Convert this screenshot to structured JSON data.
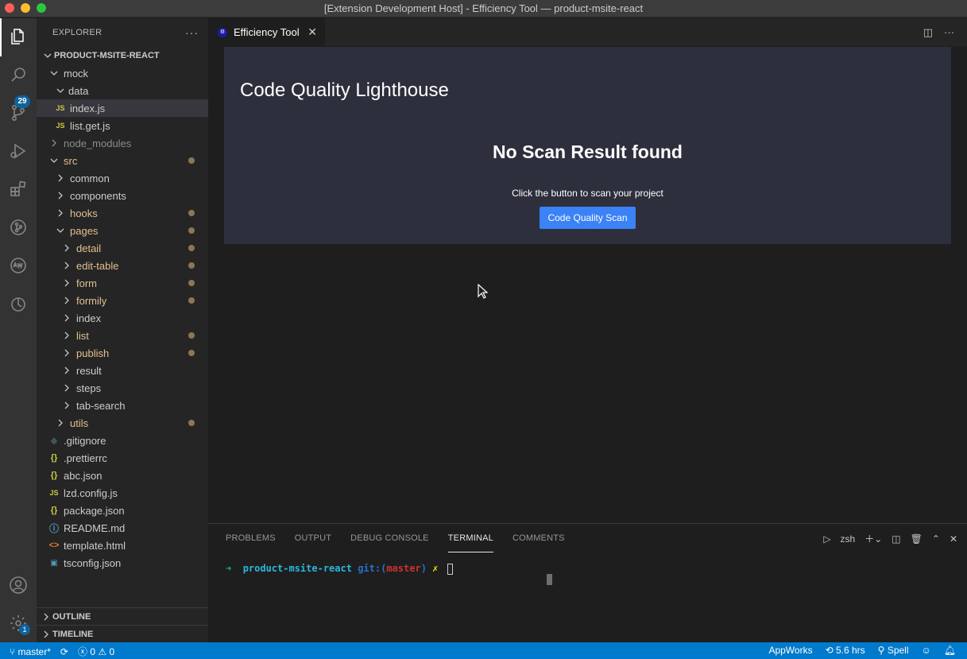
{
  "window": {
    "title": "[Extension Development Host] - Efficiency Tool — product-msite-react"
  },
  "activity_bar": {
    "scm_badge": "29",
    "settings_badge": "1"
  },
  "sidebar": {
    "title": "EXPLORER",
    "more": "···",
    "project": "PRODUCT-MSITE-REACT",
    "tree": {
      "mock": "mock",
      "data": "data",
      "index_js": "index.js",
      "list_get_js": "list.get.js",
      "node_modules": "node_modules",
      "src": "src",
      "common": "common",
      "components": "components",
      "hooks": "hooks",
      "pages": "pages",
      "detail": "detail",
      "edit_table": "edit-table",
      "form": "form",
      "formily": "formily",
      "index": "index",
      "list": "list",
      "publish": "publish",
      "result": "result",
      "steps": "steps",
      "tab_search": "tab-search",
      "utils": "utils",
      "gitignore": ".gitignore",
      "prettierrc": ".prettierrc",
      "abc_json": "abc.json",
      "lzd_config": "lzd.config.js",
      "package_json": "package.json",
      "readme": "README.md",
      "template_html": "template.html",
      "tsconfig": "tsconfig.json"
    },
    "outline": "OUTLINE",
    "timeline": "TIMELINE"
  },
  "editor": {
    "tab_label": "Efficiency Tool",
    "webview": {
      "title": "Code Quality Lighthouse",
      "heading": "No Scan Result found",
      "subtitle": "Click the button to scan your project",
      "button": "Code Quality Scan"
    }
  },
  "panel": {
    "tabs": [
      "PROBLEMS",
      "OUTPUT",
      "DEBUG CONSOLE",
      "TERMINAL",
      "COMMENTS"
    ],
    "active_tab": "TERMINAL",
    "shell": "zsh",
    "terminal": {
      "arrow": "➜",
      "project": "product-msite-react",
      "git_prefix": "git:(",
      "branch": "master",
      "git_suffix": ")",
      "dirty": "✗"
    }
  },
  "statusbar": {
    "branch": "master*",
    "errors": "0",
    "warnings": "0",
    "appworks": "AppWorks",
    "time": "5.6 hrs",
    "spell": "Spell"
  }
}
